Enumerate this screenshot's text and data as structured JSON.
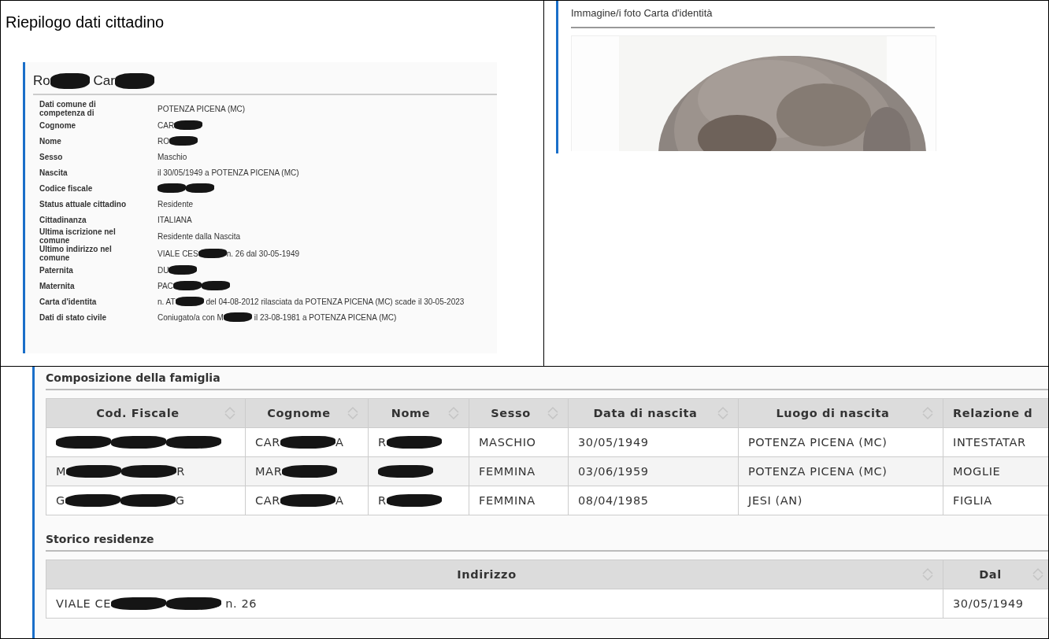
{
  "summary": {
    "title": "Riepilogo dati cittadino",
    "heading": [
      {
        "kind": "text",
        "text": "Ro"
      },
      {
        "kind": "redaction"
      },
      {
        "kind": "text",
        "text": " Car"
      },
      {
        "kind": "redaction"
      }
    ],
    "fields": [
      {
        "label": "Dati comune di competenza di",
        "value": [
          {
            "kind": "text",
            "text": "POTENZA PICENA (MC)"
          }
        ]
      },
      {
        "label": "Cognome",
        "value": [
          {
            "kind": "text",
            "text": "CAR"
          },
          {
            "kind": "redaction"
          }
        ]
      },
      {
        "label": "Nome",
        "value": [
          {
            "kind": "text",
            "text": "RO"
          },
          {
            "kind": "redaction"
          }
        ]
      },
      {
        "label": "Sesso",
        "value": [
          {
            "kind": "text",
            "text": "Maschio"
          }
        ]
      },
      {
        "label": "Nascita",
        "value": [
          {
            "kind": "text",
            "text": "il 30/05/1949 a POTENZA PICENA (MC)"
          }
        ]
      },
      {
        "label": "Codice fiscale",
        "value": [
          {
            "kind": "redaction"
          },
          {
            "kind": "redaction"
          }
        ]
      },
      {
        "label": "Status attuale cittadino",
        "value": [
          {
            "kind": "text",
            "text": "Residente"
          }
        ]
      },
      {
        "label": "Cittadinanza",
        "value": [
          {
            "kind": "text",
            "text": "ITALIANA"
          }
        ]
      },
      {
        "label": "Ultima iscrizione nel comune",
        "value": [
          {
            "kind": "text",
            "text": "Residente dalla Nascita"
          }
        ]
      },
      {
        "label": "Ultimo indirizzo nel comune",
        "value": [
          {
            "kind": "text",
            "text": "VIALE CES"
          },
          {
            "kind": "redaction"
          },
          {
            "kind": "text",
            "text": "n. 26 dal 30-05-1949"
          }
        ]
      },
      {
        "label": "Paternita",
        "value": [
          {
            "kind": "text",
            "text": "DU"
          },
          {
            "kind": "redaction"
          }
        ]
      },
      {
        "label": "Maternita",
        "value": [
          {
            "kind": "text",
            "text": "PAC"
          },
          {
            "kind": "redaction"
          },
          {
            "kind": "redaction"
          }
        ]
      },
      {
        "label": "Carta d'identita",
        "value": [
          {
            "kind": "text",
            "text": "n. AT"
          },
          {
            "kind": "redaction"
          },
          {
            "kind": "text",
            "text": " del 04-08-2012 rilasciata da POTENZA PICENA (MC) scade il 30-05-2023"
          }
        ]
      },
      {
        "label": "Dati di stato civile",
        "value": [
          {
            "kind": "text",
            "text": "Coniugato/a con M"
          },
          {
            "kind": "redaction"
          },
          {
            "kind": "text",
            "text": " il 23-08-1981 a POTENZA PICENA (MC)"
          }
        ]
      }
    ]
  },
  "photo": {
    "title": "Immagine/i foto Carta d'identità",
    "kind": "picture"
  },
  "family": {
    "title": "Composizione della famiglia",
    "columns": [
      {
        "label": "Cod. Fiscale",
        "sortable": true
      },
      {
        "label": "Cognome",
        "sortable": true
      },
      {
        "label": "Nome",
        "sortable": true
      },
      {
        "label": "Sesso",
        "sortable": true
      },
      {
        "label": "Data di nascita",
        "sortable": true
      },
      {
        "label": "Luogo di nascita",
        "sortable": true
      },
      {
        "label": "Relazione d",
        "sortable": false
      }
    ],
    "rows": [
      [
        [
          {
            "kind": "redaction"
          },
          {
            "kind": "redaction"
          },
          {
            "kind": "redaction"
          }
        ],
        [
          {
            "kind": "text",
            "text": "CAR"
          },
          {
            "kind": "redaction"
          },
          {
            "kind": "text",
            "text": "A"
          }
        ],
        [
          {
            "kind": "text",
            "text": "R"
          },
          {
            "kind": "redaction"
          }
        ],
        [
          {
            "kind": "text",
            "text": "MASCHIO"
          }
        ],
        [
          {
            "kind": "text",
            "text": "30/05/1949"
          }
        ],
        [
          {
            "kind": "text",
            "text": "POTENZA PICENA (MC)"
          }
        ],
        [
          {
            "kind": "text",
            "text": "INTESTATAR"
          }
        ]
      ],
      [
        [
          {
            "kind": "text",
            "text": "M"
          },
          {
            "kind": "redaction"
          },
          {
            "kind": "redaction"
          },
          {
            "kind": "text",
            "text": "R"
          }
        ],
        [
          {
            "kind": "text",
            "text": "MAR"
          },
          {
            "kind": "redaction"
          }
        ],
        [
          {
            "kind": "redaction"
          }
        ],
        [
          {
            "kind": "text",
            "text": "FEMMINA"
          }
        ],
        [
          {
            "kind": "text",
            "text": "03/06/1959"
          }
        ],
        [
          {
            "kind": "text",
            "text": "POTENZA PICENA (MC)"
          }
        ],
        [
          {
            "kind": "text",
            "text": "MOGLIE"
          }
        ]
      ],
      [
        [
          {
            "kind": "text",
            "text": "G"
          },
          {
            "kind": "redaction"
          },
          {
            "kind": "redaction"
          },
          {
            "kind": "text",
            "text": "G"
          }
        ],
        [
          {
            "kind": "text",
            "text": "CAR"
          },
          {
            "kind": "redaction"
          },
          {
            "kind": "text",
            "text": "A"
          }
        ],
        [
          {
            "kind": "text",
            "text": "R"
          },
          {
            "kind": "redaction"
          }
        ],
        [
          {
            "kind": "text",
            "text": "FEMMINA"
          }
        ],
        [
          {
            "kind": "text",
            "text": "08/04/1985"
          }
        ],
        [
          {
            "kind": "text",
            "text": "JESI (AN)"
          }
        ],
        [
          {
            "kind": "text",
            "text": "FIGLIA"
          }
        ]
      ]
    ]
  },
  "residences": {
    "title": "Storico residenze",
    "columns": [
      {
        "label": "Indirizzo",
        "sortable": true
      },
      {
        "label": "Dal",
        "sortable": true
      }
    ],
    "rows": [
      [
        [
          {
            "kind": "text",
            "text": "VIALE CE"
          },
          {
            "kind": "redaction"
          },
          {
            "kind": "redaction"
          },
          {
            "kind": "text",
            "text": " n. 26"
          }
        ],
        [
          {
            "kind": "text",
            "text": "30/05/1949"
          }
        ]
      ]
    ]
  }
}
